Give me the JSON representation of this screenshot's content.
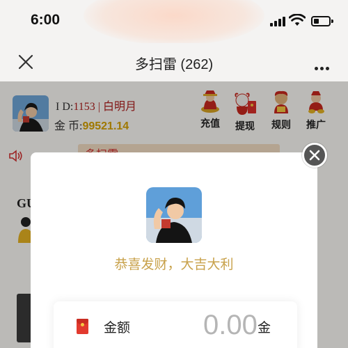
{
  "status_bar": {
    "time": "6:00"
  },
  "nav": {
    "title": "多扫雷 (262)"
  },
  "profile": {
    "id_label": "I D:",
    "id_value": "1153 | 白明月",
    "coin_label": "金 币:",
    "coin_value": "99521.14"
  },
  "actions": [
    {
      "label": "充值",
      "icon": "god-of-wealth-icon"
    },
    {
      "label": "提现",
      "icon": "ox-red-envelope-icon"
    },
    {
      "label": "规则",
      "icon": "rules-character-icon"
    },
    {
      "label": "推广",
      "icon": "promotion-character-icon"
    }
  ],
  "marquee": {
    "text": "多扫雷"
  },
  "side_text": "GU",
  "modal": {
    "congrats": "恭喜发财，大吉大利",
    "amount_label": "金额",
    "amount_value": "0.00",
    "amount_unit": "金"
  },
  "colors": {
    "accent_gold": "#c8a14a",
    "id_red": "#b02020",
    "coin_gold": "#d7a200",
    "envelope_red": "#e23a2e"
  }
}
